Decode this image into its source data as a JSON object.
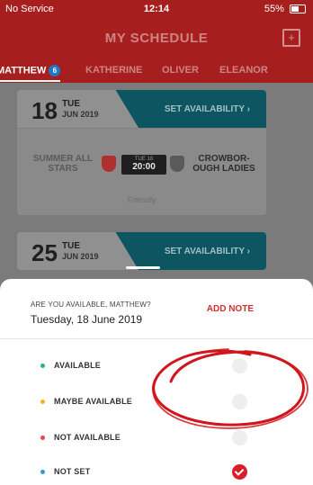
{
  "status": {
    "carrier": "No Service",
    "time": "12:14",
    "battery": "55%"
  },
  "header": {
    "title": "MY SCHEDULE",
    "calendar_icon": "calendar-plus-icon"
  },
  "tabs": [
    {
      "label": "MATTHEW",
      "badge": "6",
      "active": true
    },
    {
      "label": "KATHERINE",
      "active": false
    },
    {
      "label": "OLIVER",
      "active": false
    },
    {
      "label": "ELEANOR",
      "active": false
    }
  ],
  "events": [
    {
      "day": "18",
      "weekday": "TUE",
      "month_year": "JUN 2019",
      "action": "SET AVAILABILITY",
      "home_team": "SUMMER ALL STARS",
      "away_team": "CROWBOR-OUGH LADIES",
      "kickoff_day": "TUE 18",
      "kickoff_time": "20:00",
      "type": "Friendly"
    },
    {
      "day": "25",
      "weekday": "TUE",
      "month_year": "JUN 2019",
      "action": "SET AVAILABILITY"
    }
  ],
  "sheet": {
    "question": "ARE YOU AVAILABLE, MATTHEW?",
    "date": "Tuesday, 18 June 2019",
    "add_note": "ADD NOTE",
    "options": [
      {
        "label": "AVAILABLE",
        "color": "#2bb673",
        "selected": false
      },
      {
        "label": "MAYBE AVAILABLE",
        "color": "#f5b323",
        "selected": false
      },
      {
        "label": "NOT AVAILABLE",
        "color": "#e8474c",
        "selected": false
      },
      {
        "label": "NOT SET",
        "color": "#2a9fd6",
        "selected": true
      }
    ]
  },
  "colors": {
    "brand": "#a61e1e",
    "accent_red": "#d32f2f",
    "teal": "#0c5561",
    "annotation": "#d0161c"
  }
}
